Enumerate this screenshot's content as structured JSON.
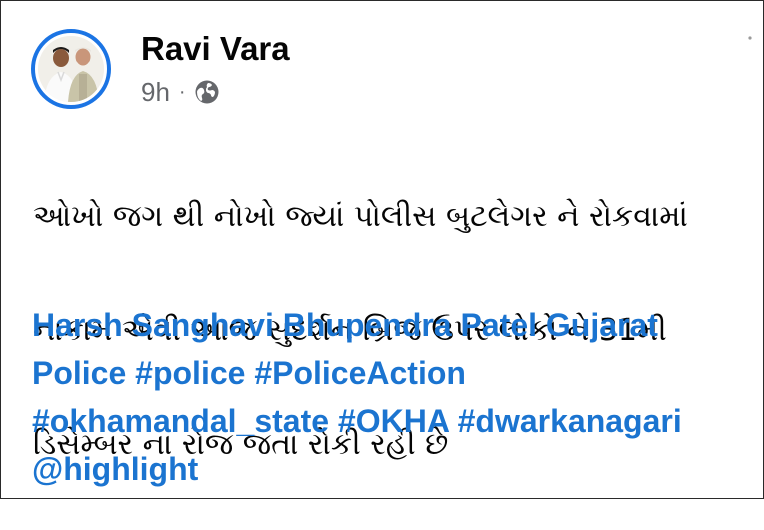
{
  "post": {
    "author": "Ravi Vara",
    "time": "9h",
    "separator": "·",
    "privacy_icon": "globe-icon",
    "avatar_icon": "profile-photo",
    "message_lines": [
      "ઓખો જગ થી નોખો જ્યાં પોલીસ બુટલેગર ને રોકવામાં",
      "નાકામ એવી આજ સુદર્શન બ્રિજ ઉપર લોકો ને 31મી",
      "ડિસેમ્બર ના રોજ જતા રોકી રહી છે"
    ],
    "tag_lines": [
      [
        "Harsh Sanghavi",
        "Bhupendra Patel",
        "Gujarat"
      ],
      [
        "Police",
        "#police",
        "#PoliceAction"
      ],
      [
        "#okhamandal_state",
        "#OKHA",
        "#dwarkanagari"
      ],
      [
        "@highlight"
      ]
    ]
  },
  "colors": {
    "accent": "#1b74e4",
    "link": "#1b74d0",
    "text": "#050505",
    "meta": "#65676b"
  }
}
